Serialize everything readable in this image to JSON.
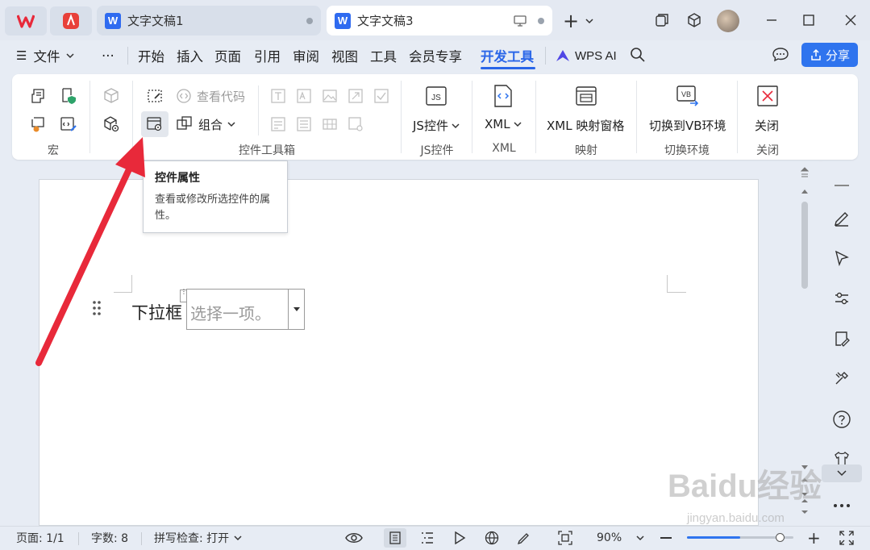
{
  "titlebar": {
    "tabs": [
      {
        "title": "文字文稿1",
        "active": false
      },
      {
        "title": "文字文稿3",
        "active": true
      }
    ],
    "new_tab_symbol": "+",
    "win_controls": [
      "restore-windows-icon",
      "cube-icon",
      "avatar",
      "minimize-icon",
      "maximize-icon",
      "close-icon"
    ]
  },
  "menubar": {
    "file_label": "文件",
    "more_label": "···",
    "items": [
      "开始",
      "插入",
      "页面",
      "引用",
      "审阅",
      "视图",
      "工具",
      "会员专享",
      "开发工具"
    ],
    "active_item": "开发工具",
    "ai_label": "WPS AI",
    "share_label": "分享"
  },
  "ribbon": {
    "groups": [
      {
        "label": "宏"
      },
      {
        "label": "控件工具箱",
        "buttons": {
          "view_code": "查看代码",
          "combine": "组合"
        }
      },
      {
        "label": "JS控件",
        "button": "JS控件"
      },
      {
        "label": "XML",
        "button": "XML"
      },
      {
        "label": "映射",
        "button": "XML 映射窗格"
      },
      {
        "label": "切换环境",
        "button": "切换到VB环境"
      },
      {
        "label": "关闭",
        "button": "关闭"
      }
    ],
    "js_icon_text": "JS",
    "vb_icon_text": "VB"
  },
  "tooltip": {
    "title": "控件属性",
    "description": "查看或修改所选控件的属性。"
  },
  "document": {
    "label_text": "下拉框",
    "dropdown_placeholder": "选择一项。"
  },
  "statusbar": {
    "page": "页面: 1/1",
    "word_count": "字数: 8",
    "spell_check": "拼写检查: 打开",
    "zoom": "90%",
    "zoom_fraction": 0.5
  },
  "watermark": {
    "text": "Baidu经验",
    "url": "jingyan.baidu.com"
  },
  "colors": {
    "accent": "#2f74ee",
    "arrow": "#e8293a",
    "active_menu": "#2a66e8"
  }
}
